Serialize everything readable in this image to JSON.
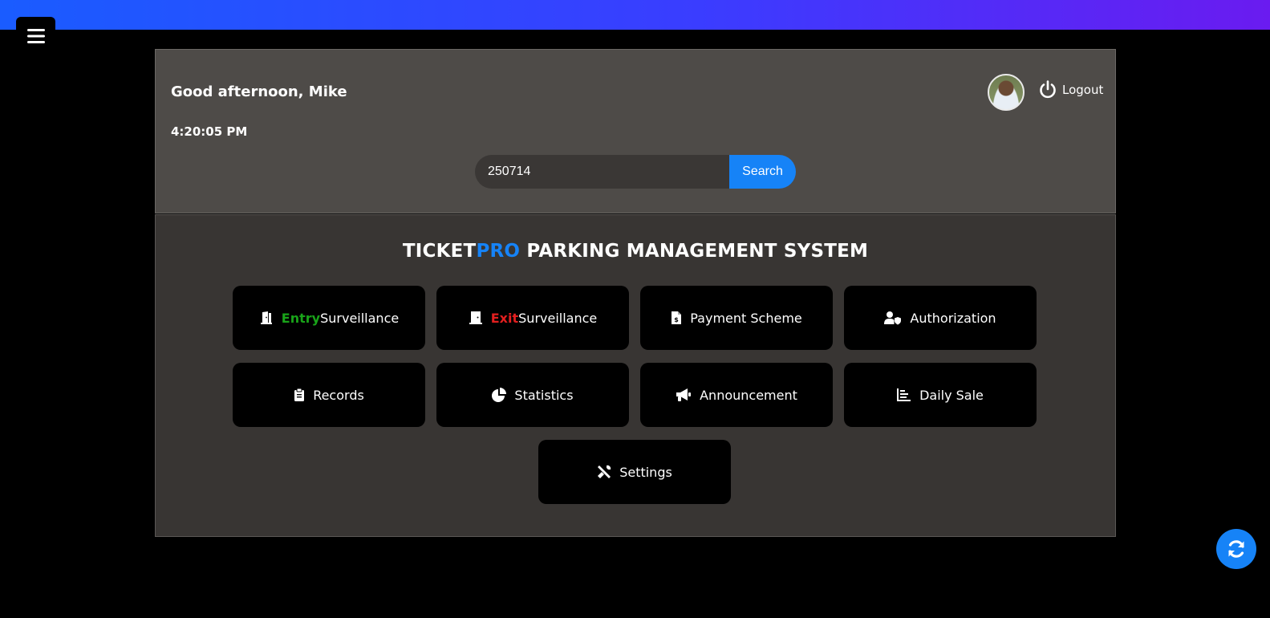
{
  "header": {
    "greeting": "Good afternoon, Mike",
    "time": "4:20:05 PM",
    "logout_label": "Logout"
  },
  "search": {
    "value": "250714",
    "button_label": "Search"
  },
  "main": {
    "title_part1": "TICKET",
    "title_part2": "PRO",
    "title_part3": " PARKING MANAGEMENT SYSTEM",
    "tiles": [
      {
        "prefix": "Entry",
        "label": "Surveillance",
        "icon": "door-entry-icon"
      },
      {
        "prefix": "Exit",
        "label": "Surveillance",
        "icon": "door-exit-icon"
      },
      {
        "label": "Payment Scheme",
        "icon": "invoice-dollar-icon"
      },
      {
        "label": "Authorization",
        "icon": "user-shield-icon"
      },
      {
        "label": "Records",
        "icon": "clipboard-icon"
      },
      {
        "label": "Statistics",
        "icon": "pie-chart-icon"
      },
      {
        "label": "Announcement",
        "icon": "megaphone-icon"
      },
      {
        "label": "Daily Sale",
        "icon": "bar-chart-icon"
      },
      {
        "label": "Settings",
        "icon": "tools-icon"
      }
    ]
  },
  "colors": {
    "accent": "#1683f7",
    "entry": "#19a319",
    "exit": "#e21f1f",
    "header_bg": "#4e4b48",
    "main_bg": "#383533"
  }
}
